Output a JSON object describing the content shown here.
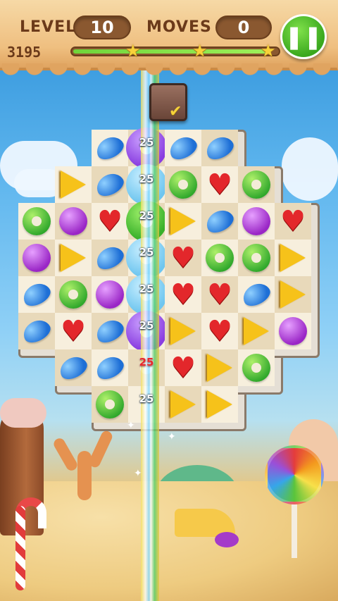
{
  "hud": {
    "level_label": "LEVEL",
    "level_value": "10",
    "moves_label": "MOVES",
    "moves_value": "0",
    "score": "3195",
    "progress_fraction": 0.97,
    "stars": [
      "star-icon",
      "star-icon",
      "star-icon"
    ],
    "pause_icon": "pause-icon",
    "pause_symbol": "❚❚"
  },
  "board": {
    "rows": [
      [
        "",
        "",
        "bean",
        "donut-purple",
        "bean",
        "bean",
        "",
        "",
        ""
      ],
      [
        "",
        "tri",
        "bean",
        "donut-blue",
        "ring",
        "heart",
        "ring",
        "",
        ""
      ],
      [
        "ring",
        "ball",
        "heart",
        "donut-green",
        "tri",
        "bean",
        "ball",
        "heart",
        ""
      ],
      [
        "ball",
        "tri",
        "bean",
        "donut-blue",
        "heart",
        "ring",
        "ring",
        "tri",
        ""
      ],
      [
        "bean",
        "ring",
        "ball",
        "donut-blue",
        "heart",
        "heart",
        "bean",
        "tri",
        ""
      ],
      [
        "bean",
        "heart",
        "bean",
        "donut-purple",
        "tri",
        "heart",
        "tri",
        "ball",
        ""
      ],
      [
        "",
        "bean",
        "bean",
        "donut-red",
        "heart",
        "tri",
        "ring",
        "",
        ""
      ],
      [
        "",
        "",
        "ring",
        "donut-purple-small",
        "tri",
        "tri",
        "",
        "",
        ""
      ]
    ],
    "donut_label": "25"
  },
  "overlay": {
    "chest_icon": "crate-icon",
    "checkmark_symbol": "✔"
  }
}
